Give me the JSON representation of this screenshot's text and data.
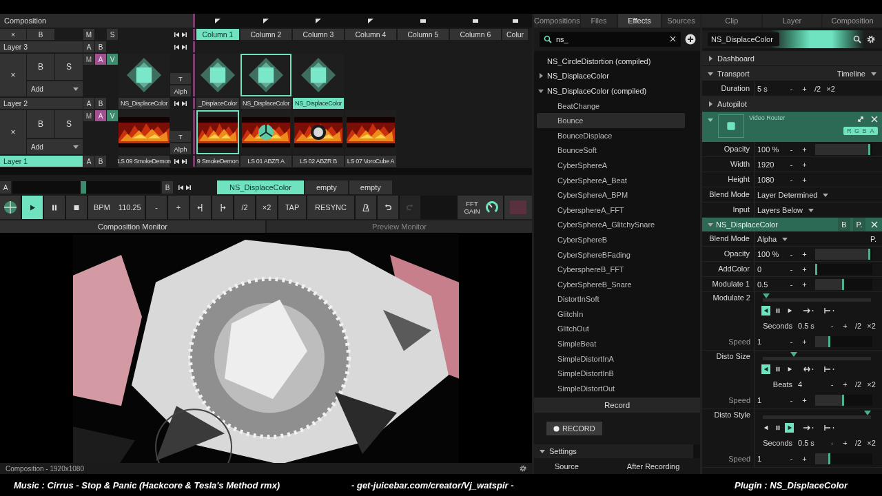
{
  "composition": {
    "title": "Composition",
    "footer": "Composition - 1920x1080"
  },
  "header": {
    "clear": "×",
    "bypass": "B",
    "mute": "M",
    "solo": "S"
  },
  "columns": [
    {
      "label": "Column 1",
      "selected": true,
      "playing": true
    },
    {
      "label": "Column 2",
      "selected": false,
      "playing": true
    },
    {
      "label": "Column 3",
      "selected": false,
      "playing": true
    },
    {
      "label": "Column 4",
      "selected": false,
      "playing": true
    },
    {
      "label": "Column 5",
      "selected": false,
      "playing": false
    },
    {
      "label": "Column 6",
      "selected": false,
      "playing": false
    },
    {
      "label": "Colur",
      "selected": false,
      "playing": false
    }
  ],
  "layers": [
    {
      "name": "Layer 3",
      "selected": false,
      "a": "A",
      "b": "B",
      "clear": "×",
      "bypass": "B",
      "solo": "S",
      "add": "Add",
      "t": "T",
      "alpha": "Alph",
      "toggles": [
        {
          "label": "M",
          "on": false
        },
        {
          "label": "A",
          "on": true
        },
        {
          "label": "V",
          "on": true
        }
      ],
      "thumb": {
        "kind": "diamond",
        "name": "NS_DisplaceColor"
      },
      "clips": [
        {
          "kind": "diamond",
          "name": "_DisplaceColor",
          "selected": false,
          "connected": false
        },
        {
          "kind": "diamond",
          "name": "NS_DisplaceColor",
          "selected": true,
          "connected": false
        },
        {
          "kind": "diamond",
          "name": "NS_DisplaceColor",
          "selected": false,
          "connected": true
        },
        {
          "kind": "empty"
        },
        {
          "kind": "empty"
        },
        {
          "kind": "empty"
        },
        {
          "kind": "empty"
        }
      ]
    },
    {
      "name": "Layer 2",
      "selected": false,
      "a": "A",
      "b": "B",
      "clear": "×",
      "bypass": "B",
      "solo": "S",
      "add": "Add",
      "t": "T",
      "alpha": "Alph",
      "toggles": [
        {
          "label": "M",
          "on": false
        },
        {
          "label": "A",
          "on": true
        },
        {
          "label": "V",
          "on": true
        }
      ],
      "thumb": {
        "kind": "picture",
        "name": "LS 09 SmokeDemon"
      },
      "clips": [
        {
          "kind": "picture",
          "name": "9 SmokeDemon",
          "selected": true,
          "connected": false
        },
        {
          "kind": "picture",
          "name": "LS 01 ABZR A",
          "selected": false,
          "connected": false
        },
        {
          "kind": "picture",
          "name": "LS 02 ABZR B",
          "selected": false,
          "connected": false
        },
        {
          "kind": "picture",
          "name": "LS 07 VoroCube A",
          "selected": false,
          "connected": false
        },
        {
          "kind": "empty"
        },
        {
          "kind": "empty"
        },
        {
          "kind": "empty"
        }
      ]
    },
    {
      "name": "Layer 1",
      "selected": true,
      "a": "A",
      "b": "B"
    }
  ],
  "deck": {
    "a": "A",
    "b": "B",
    "crossfader": {
      "level": 0.48
    },
    "tabs": [
      {
        "label": "NS_DisplaceColor",
        "selected": true
      },
      {
        "label": "empty",
        "selected": false
      },
      {
        "label": "empty",
        "selected": false
      }
    ]
  },
  "transport": [
    {
      "kind": "beat"
    },
    {
      "kind": "play",
      "selected": true
    },
    {
      "kind": "pause",
      "selected": false
    },
    {
      "kind": "stop",
      "selected": false
    },
    {
      "kind": "bpm",
      "label": "BPM",
      "value": "110.25"
    },
    {
      "kind": "text",
      "label": "-"
    },
    {
      "kind": "text",
      "label": "+"
    },
    {
      "kind": "nudge_back",
      "disabled": false
    },
    {
      "kind": "nudge_forward",
      "disabled": false
    },
    {
      "kind": "text",
      "label": "/2"
    },
    {
      "kind": "text",
      "label": "×2"
    },
    {
      "kind": "text",
      "label": "TAP"
    },
    {
      "kind": "text",
      "label": "RESYNC"
    },
    {
      "kind": "metronome",
      "disabled": false
    },
    {
      "kind": "undo",
      "disabled": false
    },
    {
      "kind": "redo",
      "disabled": true
    },
    {
      "kind": "fft",
      "label": "FFT GAIN"
    },
    {
      "kind": "swatch"
    }
  ],
  "monitors": [
    {
      "label": "Composition Monitor",
      "selected": true
    },
    {
      "label": "Preview Monitor",
      "selected": false
    }
  ],
  "monitor": {
    "kind": "picture"
  },
  "browser": {
    "tabs": [
      {
        "label": "Compositions",
        "selected": false
      },
      {
        "label": "Files",
        "selected": false
      },
      {
        "label": "Effects",
        "selected": true
      },
      {
        "label": "Sources",
        "selected": false
      }
    ],
    "search": {
      "value": "ns_"
    },
    "items": [
      {
        "kind": "effect",
        "label": "NS_CircleDistortion (compiled)",
        "selected": false
      },
      {
        "kind": "folder",
        "label": "NS_DisplaceColor",
        "expanded": false,
        "selected": false
      },
      {
        "kind": "folder",
        "label": "NS_DisplaceColor (compiled)",
        "expanded": true,
        "selected": false,
        "children": [
          {
            "kind": "effect",
            "label": "BeatChange",
            "selected": false
          },
          {
            "kind": "effect",
            "label": "Bounce",
            "selected": true
          },
          {
            "kind": "effect",
            "label": "BounceDisplace",
            "selected": false
          },
          {
            "kind": "effect",
            "label": "BounceSoft",
            "selected": false
          },
          {
            "kind": "effect",
            "label": "CyberSphereA",
            "selected": false
          },
          {
            "kind": "effect",
            "label": "CyberSphereA_Beat",
            "selected": false
          },
          {
            "kind": "effect",
            "label": "CyberSphereA_BPM",
            "selected": false
          },
          {
            "kind": "effect",
            "label": "CybersphereA_FFT",
            "selected": false
          },
          {
            "kind": "effect",
            "label": "CyberSphereA_GlitchySnare",
            "selected": false
          },
          {
            "kind": "effect",
            "label": "CyberSphereB",
            "selected": false
          },
          {
            "kind": "effect",
            "label": "CyberSphereBFading",
            "selected": false
          },
          {
            "kind": "effect",
            "label": "CybersphereB_FFT",
            "selected": false
          },
          {
            "kind": "effect",
            "label": "CyberSphereB_Snare",
            "selected": false
          },
          {
            "kind": "effect",
            "label": "DistortInSoft",
            "selected": false
          },
          {
            "kind": "effect",
            "label": "GlitchIn",
            "selected": false
          },
          {
            "kind": "effect",
            "label": "GlitchOut",
            "selected": false
          },
          {
            "kind": "effect",
            "label": "SimpleBeat",
            "selected": false
          },
          {
            "kind": "effect",
            "label": "SimpleDistortInA",
            "selected": false
          },
          {
            "kind": "effect",
            "label": "SimpleDistortInB",
            "selected": false
          },
          {
            "kind": "effect",
            "label": "SimpleDistortOut",
            "selected": false
          }
        ]
      }
    ]
  },
  "record": {
    "title": "Record",
    "button": "RECORD",
    "settings": {
      "label": "Settings",
      "expanded": true
    },
    "fields": [
      "Source",
      "After Recording"
    ]
  },
  "panel": {
    "tabs": [
      {
        "label": "Clip",
        "selected": false
      },
      {
        "label": "Layer",
        "selected": false
      },
      {
        "label": "Composition",
        "selected": false
      }
    ],
    "name": "NS_DisplaceColor",
    "sections": [
      {
        "label": "Dashboard",
        "expanded": false
      },
      {
        "label": "Transport",
        "expanded": true,
        "mode": "Timeline",
        "rows": [
          {
            "kind": "number",
            "label": "Duration",
            "value": "5 s",
            "ops": [
              "-",
              "+",
              "/2",
              "×2"
            ]
          }
        ]
      },
      {
        "label": "Autopilot",
        "expanded": false
      }
    ],
    "effects": [
      {
        "kind": "router",
        "title": "Video Router",
        "expanded": true,
        "channels": [
          "R",
          "G",
          "B",
          "A"
        ],
        "params": [
          {
            "kind": "number",
            "label": "Opacity",
            "value": "100 %",
            "ops": [
              "-",
              "+"
            ],
            "level": 1
          },
          {
            "kind": "number",
            "label": "Width",
            "value": "1920",
            "ops": [
              "-",
              "+"
            ]
          },
          {
            "kind": "number",
            "label": "Height",
            "value": "1080",
            "ops": [
              "-",
              "+"
            ]
          },
          {
            "kind": "dropdown",
            "label": "Blend Mode",
            "value": "Layer Determined"
          },
          {
            "kind": "dropdown",
            "label": "Input",
            "value": "Layers Below"
          }
        ]
      },
      {
        "kind": "plugin",
        "title": "NS_DisplaceColor",
        "expanded": true,
        "buttons": [
          "B",
          "P."
        ],
        "params": [
          {
            "kind": "dropdown",
            "label": "Blend Mode",
            "value": "Alpha",
            "extra": "P."
          },
          {
            "kind": "number",
            "label": "Opacity",
            "value": "100 %",
            "ops": [
              "-",
              "+"
            ],
            "level": 1
          },
          {
            "kind": "number",
            "label": "AddColor",
            "value": "0",
            "ops": [
              "-",
              "+"
            ],
            "level": 0
          },
          {
            "kind": "number",
            "label": "Modulate 1",
            "value": "0.5",
            "ops": [
              "-",
              "+"
            ],
            "level": 0.5
          },
          {
            "kind": "envelope",
            "label": "Modulate 2",
            "level": 0,
            "controls": [
              {
                "kind": "reverse",
                "selected": true
              },
              {
                "kind": "pause",
                "selected": false
              },
              {
                "kind": "forward",
                "selected": false
              },
              {
                "kind": "loop"
              }
            ],
            "timing": {
              "label": "Seconds",
              "value": "0.5 s",
              "ops": [
                "-",
                "+",
                "/2",
                "×2"
              ]
            },
            "speed": {
              "label": "Speed",
              "value": "1",
              "ops": [
                "-",
                "+"
              ],
              "level": 0.25
            }
          },
          {
            "kind": "envelope",
            "label": "Disto Size",
            "level": 0.27,
            "controls": [
              {
                "kind": "reverse",
                "selected": true
              },
              {
                "kind": "pause",
                "selected": false
              },
              {
                "kind": "forward",
                "selected": false
              },
              {
                "kind": "bounce"
              }
            ],
            "timing": {
              "label": "Beats",
              "value": "4",
              "ops": [
                "-",
                "+",
                "/2",
                "×2"
              ]
            },
            "speed": {
              "label": "Speed",
              "value": "1",
              "ops": [
                "-",
                "+"
              ],
              "level": 0.5
            }
          },
          {
            "kind": "envelope",
            "label": "Disto Style",
            "level": 1,
            "controls": [
              {
                "kind": "reverse",
                "selected": false
              },
              {
                "kind": "pause",
                "selected": false
              },
              {
                "kind": "forward",
                "selected": true
              },
              {
                "kind": "loop"
              }
            ],
            "timing": {
              "label": "Seconds",
              "value": "0.5 s",
              "ops": [
                "-",
                "+",
                "/2",
                "×2"
              ]
            },
            "speed": {
              "label": "Speed",
              "value": "1",
              "ops": [
                "-",
                "+"
              ],
              "level": 0.25
            }
          }
        ]
      }
    ]
  },
  "captions": [
    "Music : Cirrus - Stop & Panic (Hackcore & Tesla's Method rmx)",
    "- get-juicebar.com/creator/Vj_watspir -",
    "Plugin : NS_DisplaceColor"
  ]
}
